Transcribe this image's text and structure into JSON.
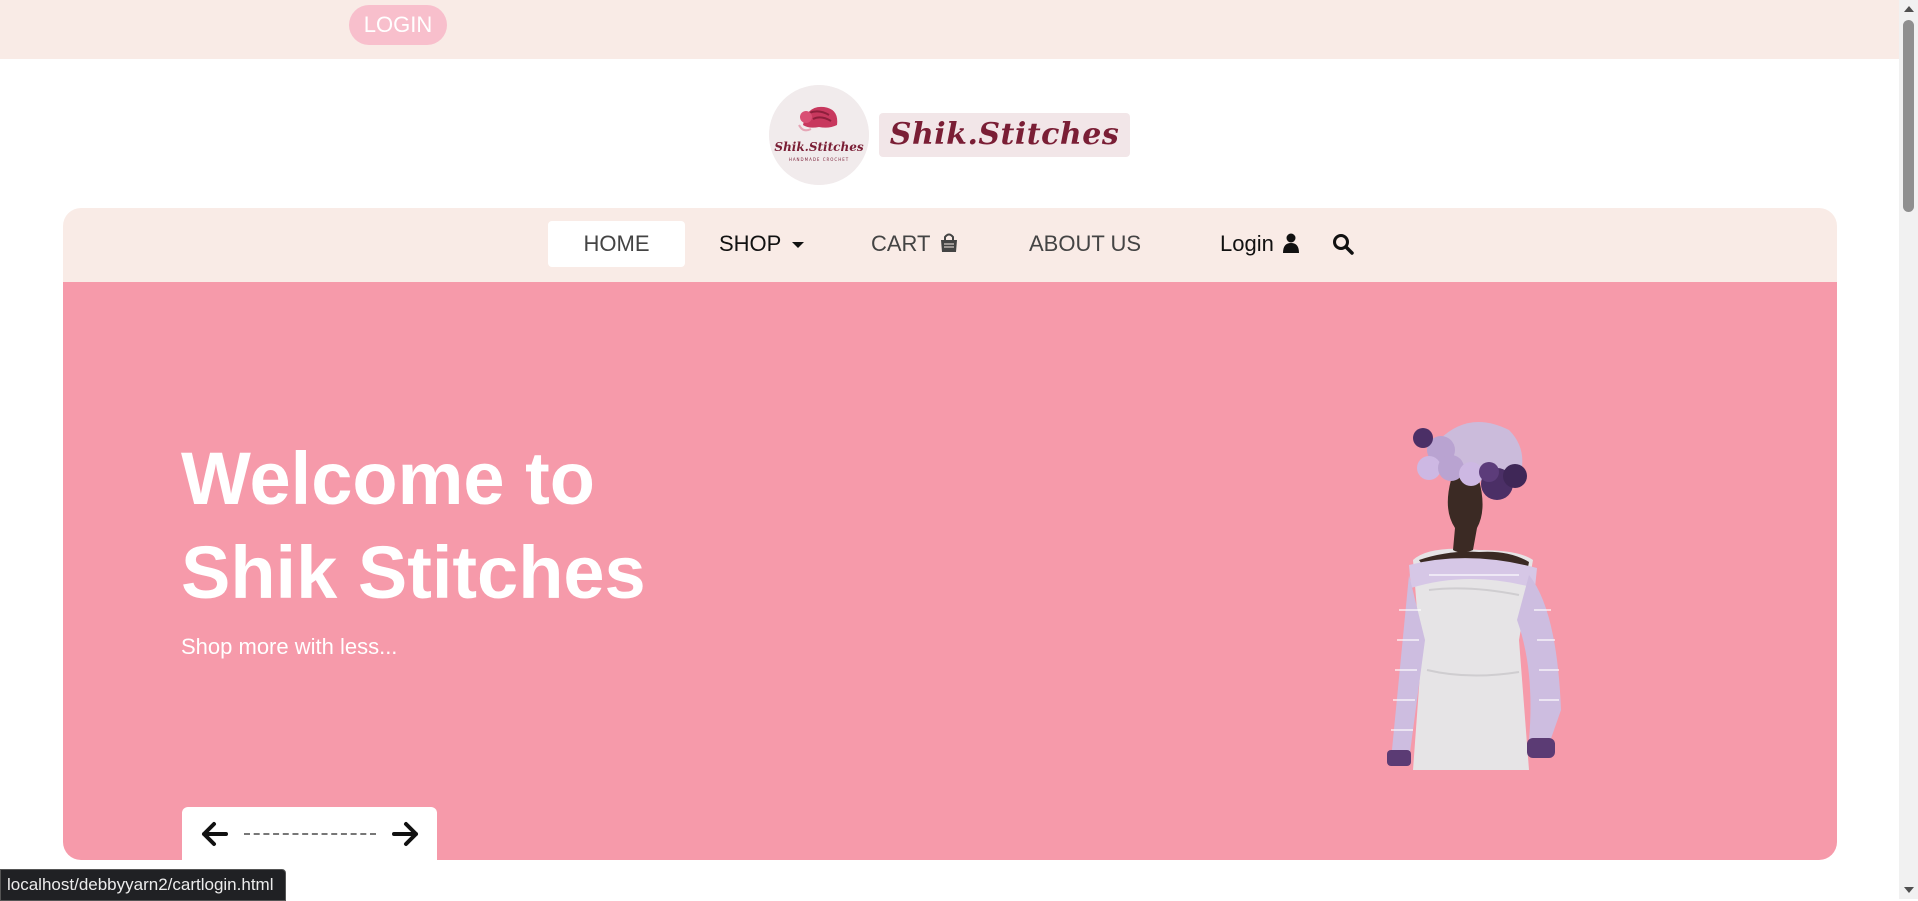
{
  "topbar": {
    "login_label": "LOGIN"
  },
  "brand": {
    "name": "Shik.Stitches",
    "logo_text": "Shik.Stitches",
    "logo_tagline": "HANDMADE CROCHET"
  },
  "nav": {
    "home": "HOME",
    "shop": "SHOP",
    "cart": "CART",
    "about": "ABOUT US",
    "login": "Login"
  },
  "hero": {
    "title_line1": "Welcome to",
    "title_line2": "Shik Stitches",
    "subtitle": "Shop more with less..."
  },
  "status_bar": {
    "url": "localhost/debbyyarn2/cartlogin.html"
  },
  "icons": {
    "shop_dropdown": "caret-down-icon",
    "cart": "shopping-bag-icon",
    "login": "user-icon",
    "search": "search-icon",
    "prev": "arrow-left-icon",
    "next": "arrow-right-icon"
  },
  "colors": {
    "topbar_bg": "#f9ebe6",
    "login_pill": "#f8bfcc",
    "hero_bg": "#f69aaa",
    "brand_text": "#7a1e35",
    "nav_bg": "#f9ebe6"
  }
}
